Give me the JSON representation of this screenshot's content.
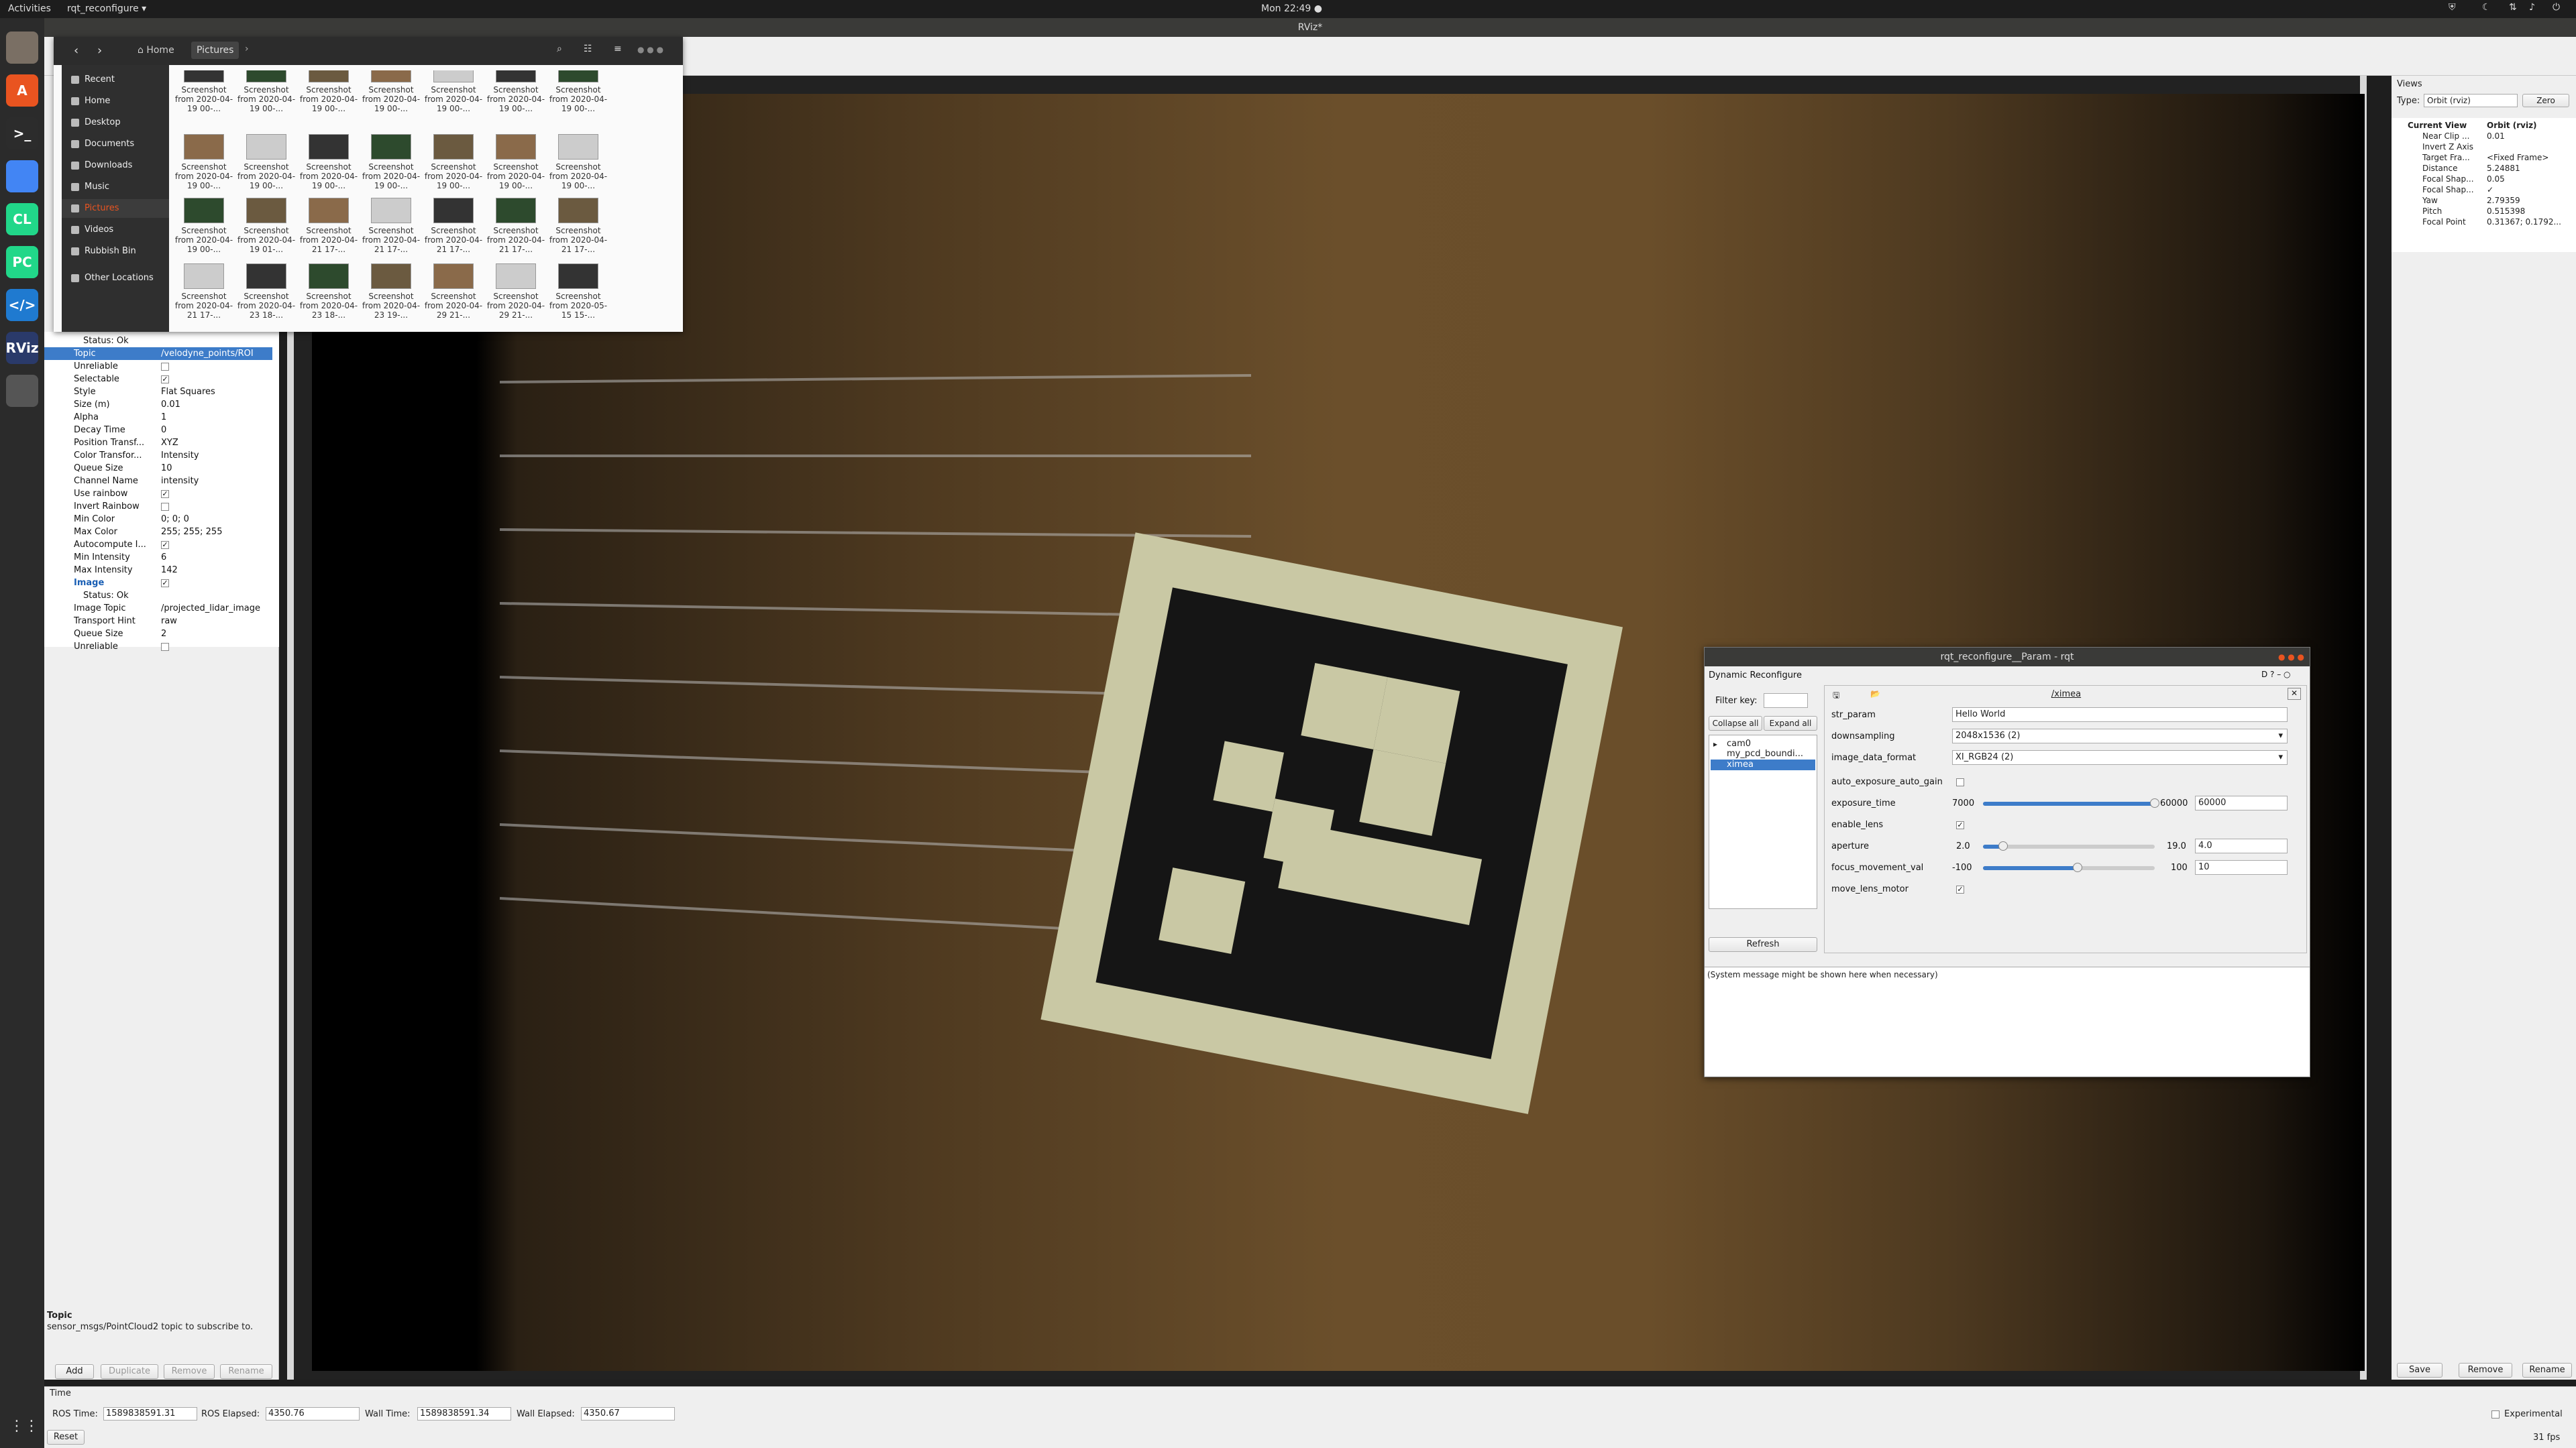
{
  "topbar": {
    "activities": "Activities",
    "app_menu": "rqt_reconfigure ▾",
    "clock": "Mon 22:49 ●"
  },
  "dock": {
    "items": [
      {
        "name": "files-icon",
        "label": ""
      },
      {
        "name": "software-icon",
        "label": "A"
      },
      {
        "name": "terminal-icon",
        "label": ">_"
      },
      {
        "name": "chrome-icon",
        "label": ""
      },
      {
        "name": "clion-icon",
        "label": "CL"
      },
      {
        "name": "pycharm-icon",
        "label": "PC"
      },
      {
        "name": "vscode-icon",
        "label": "</>"
      },
      {
        "name": "rviz-icon",
        "label": "RViz"
      },
      {
        "name": "editor-icon",
        "label": ""
      }
    ],
    "apps_grid": "⋮⋮⋮"
  },
  "rviz": {
    "title": "RViz*"
  },
  "files": {
    "path_home": "Home",
    "path_current": "Pictures",
    "sidebar": [
      {
        "label": "Recent"
      },
      {
        "label": "Home"
      },
      {
        "label": "Desktop"
      },
      {
        "label": "Documents"
      },
      {
        "label": "Downloads"
      },
      {
        "label": "Music"
      },
      {
        "label": "Pictures"
      },
      {
        "label": "Videos"
      },
      {
        "label": "Rubbish Bin"
      },
      {
        "label": "Other Locations"
      }
    ],
    "rows": [
      [
        "Screenshot from 2020-04-19 00-...",
        "Screenshot from 2020-04-19 00-...",
        "Screenshot from 2020-04-19 00-...",
        "Screenshot from 2020-04-19 00-...",
        "Screenshot from 2020-04-19 00-...",
        "Screenshot from 2020-04-19 00-...",
        "Screenshot from 2020-04-19 00-..."
      ],
      [
        "Screenshot from 2020-04-19 00-...",
        "Screenshot from 2020-04-19 00-...",
        "Screenshot from 2020-04-19 00-...",
        "Screenshot from 2020-04-19 00-...",
        "Screenshot from 2020-04-19 00-...",
        "Screenshot from 2020-04-19 00-...",
        "Screenshot from 2020-04-19 00-..."
      ],
      [
        "Screenshot from 2020-04-19 00-...",
        "Screenshot from 2020-04-19 01-...",
        "Screenshot from 2020-04-21 17-...",
        "Screenshot from 2020-04-21 17-...",
        "Screenshot from 2020-04-21 17-...",
        "Screenshot from 2020-04-21 17-...",
        "Screenshot from 2020-04-21 17-..."
      ],
      [
        "Screenshot from 2020-04-21 17-...",
        "Screenshot from 2020-04-23 18-...",
        "Screenshot from 2020-04-23 18-...",
        "Screenshot from 2020-04-23 19-...",
        "Screenshot from 2020-04-29 21-...",
        "Screenshot from 2020-04-29 21-...",
        "Screenshot from 2020-05-15 15-..."
      ]
    ]
  },
  "displays": {
    "rows": [
      {
        "k": "Status: Ok",
        "v": "",
        "type": "status"
      },
      {
        "k": "Topic",
        "v": "/velodyne_points/ROI",
        "type": "sel"
      },
      {
        "k": "Unreliable",
        "v": "",
        "type": "cb0"
      },
      {
        "k": "Selectable",
        "v": "✓",
        "type": "cb1"
      },
      {
        "k": "Style",
        "v": "Flat Squares",
        "type": "t"
      },
      {
        "k": "Size (m)",
        "v": "0.01",
        "type": "t"
      },
      {
        "k": "Alpha",
        "v": "1",
        "type": "t"
      },
      {
        "k": "Decay Time",
        "v": "0",
        "type": "t"
      },
      {
        "k": "Position Transf...",
        "v": "XYZ",
        "type": "t"
      },
      {
        "k": "Color Transfor...",
        "v": "Intensity",
        "type": "t"
      },
      {
        "k": "Queue Size",
        "v": "10",
        "type": "t"
      },
      {
        "k": "Channel Name",
        "v": "intensity",
        "type": "t"
      },
      {
        "k": "Use rainbow",
        "v": "✓",
        "type": "cb1"
      },
      {
        "k": "Invert Rainbow",
        "v": "",
        "type": "cb0"
      },
      {
        "k": "Min Color",
        "v": "0; 0; 0",
        "type": "t"
      },
      {
        "k": "Max Color",
        "v": "255; 255; 255",
        "type": "t"
      },
      {
        "k": "Autocompute I...",
        "v": "✓",
        "type": "cb1"
      },
      {
        "k": "Min Intensity",
        "v": "6",
        "type": "t"
      },
      {
        "k": "Max Intensity",
        "v": "142",
        "type": "t"
      },
      {
        "k": "Image",
        "v": "✓",
        "type": "head"
      },
      {
        "k": "Status: Ok",
        "v": "",
        "type": "status"
      },
      {
        "k": "Image Topic",
        "v": "/projected_lidar_image",
        "type": "t"
      },
      {
        "k": "Transport Hint",
        "v": "raw",
        "type": "t"
      },
      {
        "k": "Queue Size",
        "v": "2",
        "type": "t"
      },
      {
        "k": "Unreliable",
        "v": "",
        "type": "cb0"
      }
    ],
    "desc_title": "Topic",
    "desc_text": "sensor_msgs/PointCloud2 topic to subscribe to.",
    "btn_add": "Add",
    "btn_duplicate": "Duplicate",
    "btn_remove": "Remove",
    "btn_rename": "Rename"
  },
  "views": {
    "title": "Views",
    "type_label": "Type:",
    "type_value": "Orbit (rviz)",
    "zero": "Zero",
    "rows": [
      {
        "k": "Current View",
        "v": "Orbit (rviz)"
      },
      {
        "k": "Near Clip ...",
        "v": "0.01"
      },
      {
        "k": "Invert Z Axis",
        "v": ""
      },
      {
        "k": "Target Fra...",
        "v": "<Fixed Frame>"
      },
      {
        "k": "Distance",
        "v": "5.24881"
      },
      {
        "k": "Focal Shap...",
        "v": "0.05"
      },
      {
        "k": "Focal Shap...",
        "v": "✓"
      },
      {
        "k": "Yaw",
        "v": "2.79359"
      },
      {
        "k": "Pitch",
        "v": "0.515398"
      },
      {
        "k": "Focal Point",
        "v": "0.31367; 0.1792..."
      }
    ],
    "save": "Save",
    "remove": "Remove",
    "rename": "Rename"
  },
  "time": {
    "title": "Time",
    "ros_time_label": "ROS Time:",
    "ros_time": "1589838591.31",
    "ros_elapsed_label": "ROS Elapsed:",
    "ros_elapsed": "4350.76",
    "wall_time_label": "Wall Time:",
    "wall_time": "1589838591.34",
    "wall_elapsed_label": "Wall Elapsed:",
    "wall_elapsed": "4350.67",
    "experimental": "Experimental",
    "reset": "Reset",
    "fps": "31 fps"
  },
  "rqt": {
    "title": "rqt_reconfigure__Param - rqt",
    "plugin": "Dynamic Reconfigure",
    "filter_label": "Filter key:",
    "collapse": "Collapse all",
    "expand": "Expand all",
    "tree": [
      "cam0",
      "my_pcd_boundi...",
      "ximea"
    ],
    "refresh": "Refresh",
    "node": "/ximea",
    "params": {
      "str_param": "str_param",
      "str_value": "Hello World",
      "downsampling": "downsampling",
      "downsampling_value": "2048x1536 (2)",
      "image_data_format": "image_data_format",
      "image_data_format_value": "XI_RGB24 (2)",
      "auto_exposure": "auto_exposure_auto_gain",
      "exposure_time": "exposure_time",
      "exposure_min": "7000",
      "exposure_max": "60000",
      "exposure_value": "60000",
      "enable_lens": "enable_lens",
      "aperture": "aperture",
      "aperture_min": "2.0",
      "aperture_max": "19.0",
      "aperture_value": "4.0",
      "focus": "focus_movement_val",
      "focus_min": "-100",
      "focus_max": "100",
      "focus_value": "10",
      "move_lens": "move_lens_motor"
    },
    "levels": {
      "exposure": 1.0,
      "aperture": 0.118,
      "focus": 0.55
    },
    "system_message": "(System message might be shown here when necessary)"
  }
}
